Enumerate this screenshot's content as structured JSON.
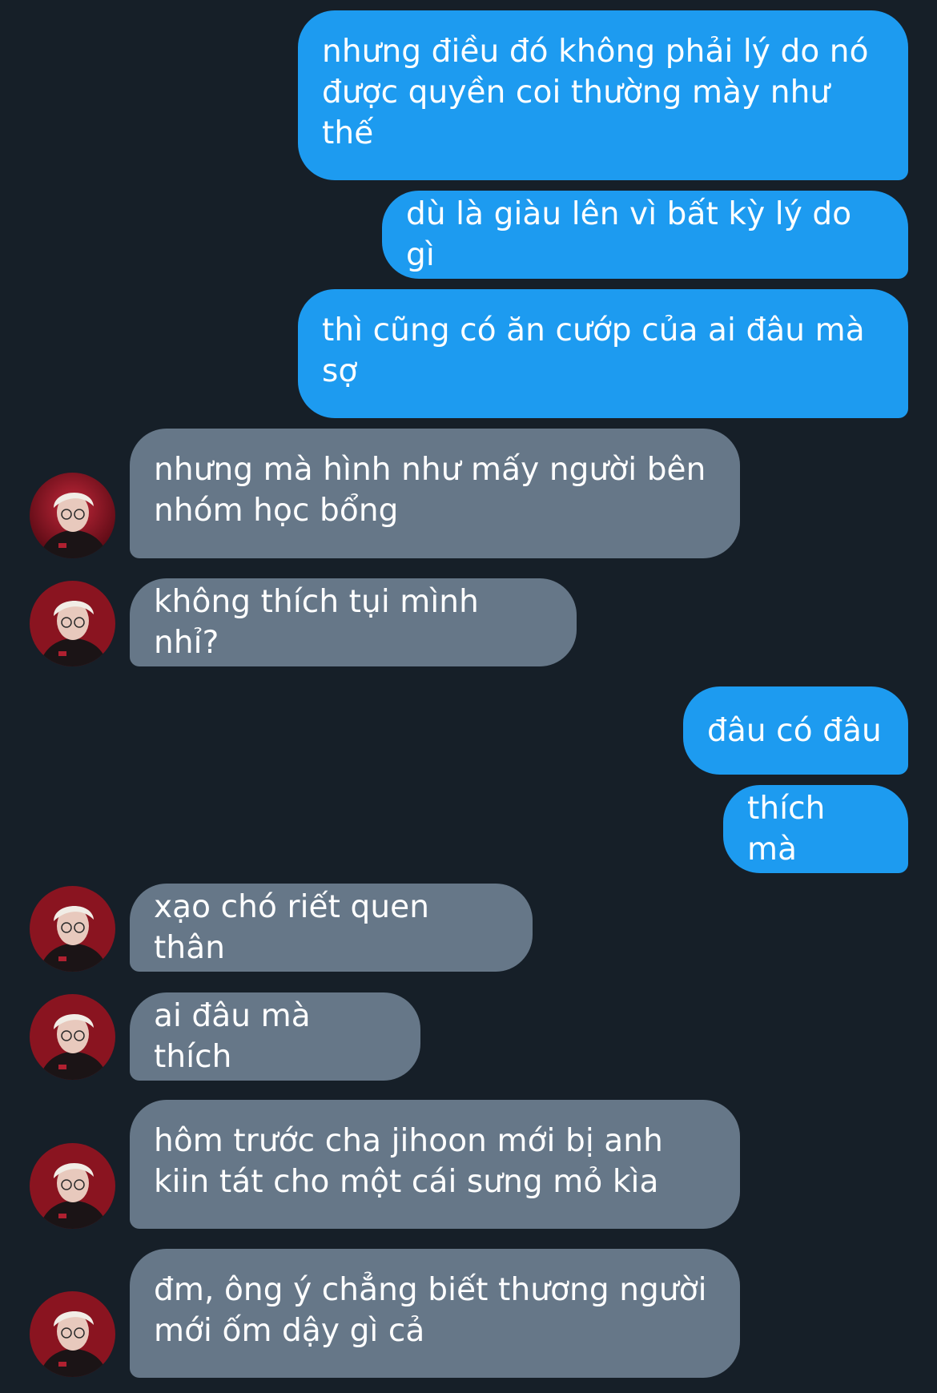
{
  "conversation": {
    "colors": {
      "background": "#161f28",
      "sent_bubble": "#1d9bf0",
      "received_bubble": "#667788",
      "text": "#ffffff"
    },
    "messages": [
      {
        "direction": "sent",
        "text": "nhưng điều đó không phải lý do nó\nđược quyền coi thường mày như\nthế"
      },
      {
        "direction": "sent",
        "text": "dù là giàu lên vì bất kỳ lý do gì"
      },
      {
        "direction": "sent",
        "text": "thì cũng có ăn cướp của ai đâu mà\nsợ"
      },
      {
        "direction": "received",
        "text": "nhưng mà hình như mấy người bên\nnhóm học bổng"
      },
      {
        "direction": "received",
        "text": "không thích tụi mình nhỉ?"
      },
      {
        "direction": "sent",
        "text": "đâu có đâu"
      },
      {
        "direction": "sent",
        "text": "thích mà"
      },
      {
        "direction": "received",
        "text": "xạo chó riết quen thân"
      },
      {
        "direction": "received",
        "text": "ai đâu mà thích"
      },
      {
        "direction": "received",
        "text": "hôm trước cha jihoon mới bị anh\nkiin tát cho một cái sưng mỏ kìa"
      },
      {
        "direction": "received",
        "text": "đm, ông ý chẳng biết thương người\nmới ốm dậy gì cả"
      }
    ]
  }
}
